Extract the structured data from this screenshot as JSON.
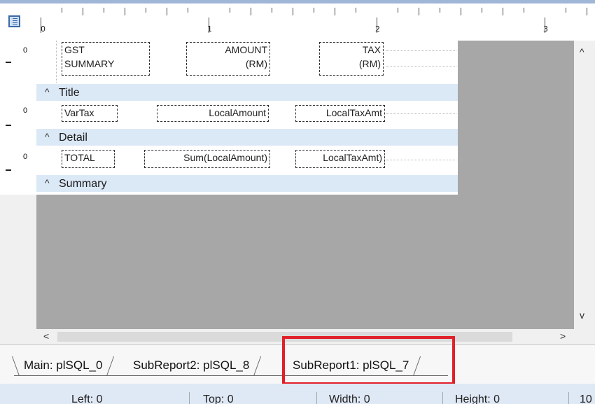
{
  "ruler": {
    "numbers": [
      "0",
      "1",
      "2",
      "3"
    ]
  },
  "row_markers": [
    "0",
    "0",
    "0"
  ],
  "bands": {
    "title": {
      "label": "Title",
      "caret": "^"
    },
    "detail": {
      "label": "Detail",
      "caret": "^"
    },
    "summary": {
      "label": "Summary",
      "caret": "^"
    }
  },
  "header_fields": {
    "gst": "GST\nSUMMARY",
    "amount": "AMOUNT\n(RM)",
    "tax": "TAX\n(RM)"
  },
  "detail_fields": {
    "vartax": "VarTax",
    "localamount": "LocalAmount",
    "localtaxamt": "LocalTaxAmt"
  },
  "summary_fields": {
    "total": "TOTAL",
    "sum_localamount": "Sum(LocalAmount)",
    "localtaxamt": "LocalTaxAmt)"
  },
  "scroll": {
    "up": "^",
    "down": "v",
    "left": "<",
    "right": ">"
  },
  "tabs": [
    {
      "label": "Main: plSQL_0"
    },
    {
      "label": "SubReport2: plSQL_8"
    },
    {
      "label": "SubReport1: plSQL_7"
    }
  ],
  "status": {
    "left": "Left: 0",
    "top": "Top: 0",
    "width": "Width: 0",
    "height": "Height: 0",
    "extra": "10"
  },
  "colors": {
    "band_bar": "#dbe8f6",
    "gray_area": "#a7a7a7",
    "highlight": "#e0202a",
    "status_bar": "#dfe8f5"
  }
}
